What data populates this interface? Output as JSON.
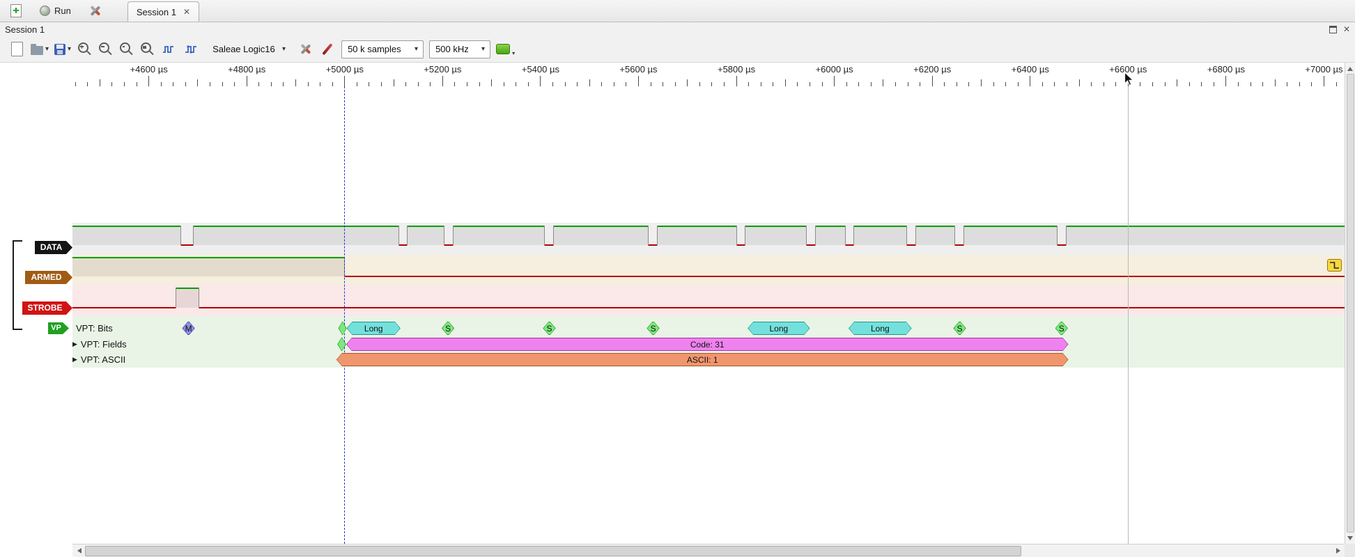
{
  "icons": {
    "close": "✕",
    "caret": "▾",
    "expand": "▶"
  },
  "topbar": {
    "run": "Run",
    "tab": "Session 1"
  },
  "dock": {
    "title": "Session 1"
  },
  "toolbar": {
    "device": "Saleae Logic16",
    "samples": "50 k samples",
    "rate": "500 kHz"
  },
  "ruler": {
    "unit": "µs",
    "view_start_us": 4444,
    "view_end_us": 7042,
    "minor_step_us": 25,
    "medium_step_us": 100,
    "major_step_us": 200,
    "labels": [
      {
        "t": 4600,
        "text": "+4600 µs"
      },
      {
        "t": 4800,
        "text": "+4800 µs"
      },
      {
        "t": 5000,
        "text": "+5000 µs"
      },
      {
        "t": 5200,
        "text": "+5200 µs"
      },
      {
        "t": 5400,
        "text": "+5400 µs"
      },
      {
        "t": 5600,
        "text": "+5600 µs"
      },
      {
        "t": 5800,
        "text": "+5800 µs"
      },
      {
        "t": 6000,
        "text": "+6000 µs"
      },
      {
        "t": 6200,
        "text": "+6200 µs"
      },
      {
        "t": 6400,
        "text": "+6400 µs"
      },
      {
        "t": 6600,
        "text": "+6600 µs"
      },
      {
        "t": 6800,
        "text": "+6800 µs"
      },
      {
        "t": 7000,
        "text": "+7000 µs"
      }
    ]
  },
  "trigger_us": 5000,
  "cursor_us": 6600,
  "palette": {
    "high": "#00a000",
    "low": "#b40000",
    "edge": "#8c8c8c",
    "trigger": "#2830c8",
    "cursor": "#b8b8b8"
  },
  "channels": [
    {
      "name": "DATA",
      "tag_color": "#141414",
      "row_bg": "#efefef",
      "segments": [
        [
          "high",
          4444,
          4665
        ],
        [
          "low",
          4665,
          4691
        ],
        [
          "high",
          4691,
          5110
        ],
        [
          "low",
          5110,
          5128
        ],
        [
          "high",
          5128,
          5203
        ],
        [
          "low",
          5203,
          5221
        ],
        [
          "high",
          5221,
          5408
        ],
        [
          "low",
          5408,
          5426
        ],
        [
          "high",
          5426,
          5620
        ],
        [
          "low",
          5620,
          5638
        ],
        [
          "high",
          5638,
          5800
        ],
        [
          "low",
          5800,
          5818
        ],
        [
          "high",
          5818,
          5943
        ],
        [
          "low",
          5943,
          5961
        ],
        [
          "high",
          5961,
          6022
        ],
        [
          "low",
          6022,
          6040
        ],
        [
          "high",
          6040,
          6148
        ],
        [
          "low",
          6148,
          6166
        ],
        [
          "high",
          6166,
          6246
        ],
        [
          "low",
          6246,
          6264
        ],
        [
          "high",
          6264,
          6455
        ],
        [
          "low",
          6455,
          6473
        ],
        [
          "high",
          6473,
          7042
        ]
      ]
    },
    {
      "name": "ARMED",
      "tag_color": "#a05c14",
      "row_bg": "#f6eede",
      "segments": [
        [
          "high",
          4444,
          5000
        ],
        [
          "low",
          5000,
          7042
        ]
      ]
    },
    {
      "name": "STROBE",
      "tag_color": "#d01414",
      "row_bg": "#fbe8e8",
      "segments": [
        [
          "low",
          4444,
          4655
        ],
        [
          "high",
          4655,
          4702
        ],
        [
          "low",
          4702,
          7042
        ]
      ]
    }
  ],
  "decoder": {
    "tag": "VP",
    "tag_color": "#20a020",
    "row_bg": "#e9f4e6",
    "rows": [
      {
        "label": "VPT: Bits",
        "expandable": false,
        "annotations": [
          {
            "t1": 4668,
            "t2": 4694,
            "text": "M",
            "fill": "#8c8ce8",
            "stroke": "#4040a0"
          },
          {
            "t1": 4987,
            "t2": 5004,
            "text": "",
            "fill": "#7ce87c",
            "stroke": "#289828"
          },
          {
            "t1": 5004,
            "t2": 5114,
            "text": "Long",
            "fill": "#74e0dc",
            "stroke": "#1e968e"
          },
          {
            "t1": 5198,
            "t2": 5224,
            "text": "S",
            "fill": "#7ce87c",
            "stroke": "#289828"
          },
          {
            "t1": 5405,
            "t2": 5431,
            "text": "S",
            "fill": "#7ce87c",
            "stroke": "#289828"
          },
          {
            "t1": 5617,
            "t2": 5643,
            "text": "S",
            "fill": "#7ce87c",
            "stroke": "#289828"
          },
          {
            "t1": 5823,
            "t2": 5950,
            "text": "Long",
            "fill": "#74e0dc",
            "stroke": "#1e968e"
          },
          {
            "t1": 6029,
            "t2": 6158,
            "text": "Long",
            "fill": "#74e0dc",
            "stroke": "#1e968e"
          },
          {
            "t1": 6243,
            "t2": 6269,
            "text": "S",
            "fill": "#7ce87c",
            "stroke": "#289828"
          },
          {
            "t1": 6451,
            "t2": 6477,
            "text": "S",
            "fill": "#7ce87c",
            "stroke": "#289828"
          }
        ]
      },
      {
        "label": "VPT: Fields",
        "expandable": true,
        "annotations": [
          {
            "t1": 4985,
            "t2": 5003,
            "text": "",
            "fill": "#7ce87c",
            "stroke": "#289828"
          },
          {
            "t1": 5003,
            "t2": 6478,
            "text": "Code: 31",
            "fill": "#ee82ee",
            "stroke": "#aa32aa"
          }
        ]
      },
      {
        "label": "VPT: ASCII",
        "expandable": true,
        "annotations": [
          {
            "t1": 4983,
            "t2": 6478,
            "text": "ASCII: 1",
            "fill": "#f0966e",
            "stroke": "#b4502a"
          }
        ]
      }
    ]
  },
  "armed_trigger_badge": {
    "fill": "#f8d83c",
    "stroke": "#94761c",
    "edge": "falling"
  }
}
